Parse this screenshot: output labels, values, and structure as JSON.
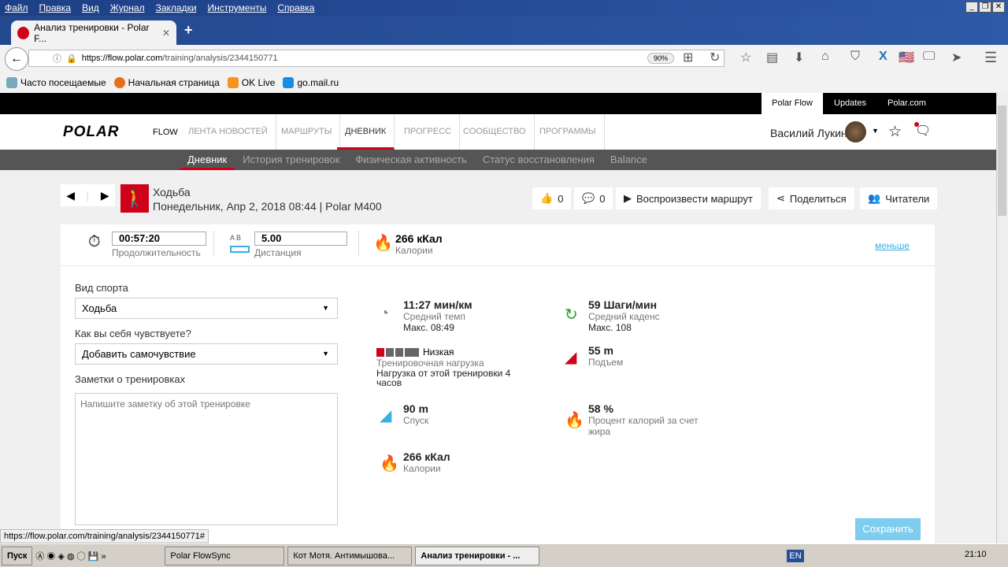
{
  "browser": {
    "menu": [
      "Файл",
      "Правка",
      "Вид",
      "Журнал",
      "Закладки",
      "Инструменты",
      "Справка"
    ],
    "tab_title": "Анализ тренировки - Polar F...",
    "url_domain": "https://flow.polar.com",
    "url_path": "/training/analysis/2344150771",
    "zoom": "90%",
    "bookmarks": [
      "Часто посещаемые",
      "Начальная страница",
      "OK Live",
      "go.mail.ru"
    ],
    "status_url": "https://flow.polar.com/training/analysis/2344150771#"
  },
  "top_links": [
    "Polar Flow",
    "Updates",
    "Polar.com"
  ],
  "header": {
    "logo": "POLAR",
    "flow": "FLOW",
    "nav": [
      "ЛЕНТА НОВОСТЕЙ",
      "МАРШРУТЫ",
      "ДНЕВНИК",
      "ПРОГРЕСС",
      "СООБЩЕСТВО",
      "ПРОГРАММЫ"
    ],
    "user": "Василий Лукин"
  },
  "subnav": [
    "Дневник",
    "История тренировок",
    "Физическая активность",
    "Статус восстановления",
    "Balance"
  ],
  "training": {
    "sport": "Ходьба",
    "date": "Понедельник, Апр 2, 2018 08:44 | Polar M400",
    "likes": "0",
    "comments": "0",
    "replay": "Воспроизвести маршрут",
    "share": "Поделиться",
    "readers": "Читатели"
  },
  "summary": {
    "duration": "00:57:20",
    "duration_label": "Продолжительность",
    "dist_ab": "A  B",
    "distance": "5.00",
    "distance_label": "Дистанция",
    "calories": "266 кКал",
    "calories_label": "Калории",
    "less": "меньше"
  },
  "form": {
    "sport_label": "Вид спорта",
    "sport_value": "Ходьба",
    "feel_label": "Как вы себя чувствуете?",
    "feel_value": "Добавить самочувствие",
    "notes_label": "Заметки о тренировках",
    "notes_placeholder": "Напишите заметку об этой тренировке",
    "save": "Сохранить"
  },
  "stats": {
    "pace": "11:27 мин/км",
    "pace_l": "Средний темп",
    "pace_m": "Макс. 08:49",
    "cadence": "59 Шаги/мин",
    "cadence_l": "Средний каденс",
    "cadence_m": "Макс. 108",
    "load": "Низкая",
    "load_l": "Тренировочная нагрузка",
    "load_m": "Нагрузка от этой тренировки 4 часов",
    "load_level": 1,
    "load_max": 5,
    "ascent": "55 m",
    "ascent_l": "Подъем",
    "descent": "90 m",
    "descent_l": "Спуск",
    "fat": "58 %",
    "fat_l": "Процент калорий за счет жира",
    "cal": "266 кКал",
    "cal_l": "Калории"
  },
  "taskbar": {
    "start": "Пуск",
    "items": [
      "Polar FlowSync",
      "Кот Мотя. Антимышова...",
      "Анализ тренировки - ..."
    ],
    "lang": "EN",
    "clock": "21:10"
  }
}
